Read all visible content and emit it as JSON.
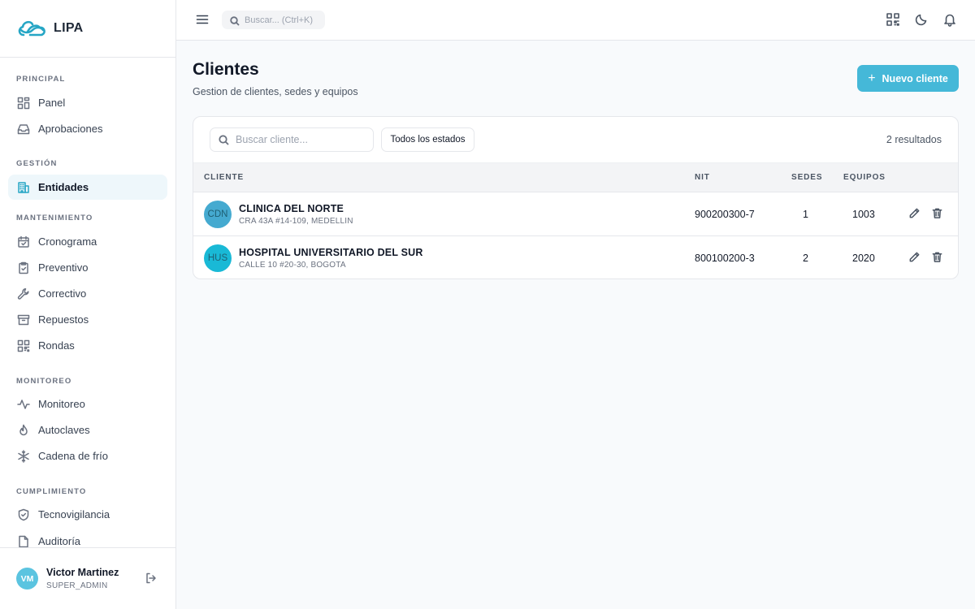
{
  "brand": {
    "name": "LIPA",
    "color": "#26a6c5"
  },
  "sidebar": {
    "sections": [
      {
        "title": "PRINCIPAL",
        "items": [
          {
            "label": "Panel",
            "icon": "grid-icon"
          },
          {
            "label": "Aprobaciones",
            "icon": "inbox-icon"
          }
        ]
      },
      {
        "title": "GESTIÓN",
        "items": [
          {
            "label": "Entidades",
            "icon": "building-icon",
            "active": true
          }
        ]
      },
      {
        "title": "MANTENIMIENTO",
        "items": [
          {
            "label": "Cronograma",
            "icon": "calendar-icon"
          },
          {
            "label": "Preventivo",
            "icon": "clipboard-icon"
          },
          {
            "label": "Correctivo",
            "icon": "wrench-icon"
          },
          {
            "label": "Repuestos",
            "icon": "archive-icon"
          },
          {
            "label": "Rondas",
            "icon": "qr-icon"
          }
        ]
      },
      {
        "title": "MONITOREO",
        "items": [
          {
            "label": "Monitoreo",
            "icon": "activity-icon"
          },
          {
            "label": "Autoclaves",
            "icon": "flame-icon"
          },
          {
            "label": "Cadena de frío",
            "icon": "snowflake-icon"
          }
        ]
      },
      {
        "title": "CUMPLIMIENTO",
        "items": [
          {
            "label": "Tecnovigilancia",
            "icon": "shield-icon"
          },
          {
            "label": "Auditoría",
            "icon": "file-icon"
          }
        ]
      }
    ]
  },
  "user": {
    "initials": "VM",
    "name": "Victor Martinez",
    "role": "SUPER_ADMIN"
  },
  "topbar": {
    "search_placeholder": "Buscar... (Ctrl+K)"
  },
  "page": {
    "title": "Clientes",
    "subtitle": "Gestion de clientes, sedes y equipos",
    "new_button": {
      "icon": "+",
      "label": "Nuevo cliente"
    }
  },
  "filters": {
    "search_placeholder": "Buscar cliente...",
    "status_label": "Todos los estados",
    "results": "2 resultados"
  },
  "table": {
    "headers": {
      "cliente": "CLIENTE",
      "nit": "NIT",
      "sedes": "SEDES",
      "equipos": "EQUIPOS"
    },
    "rows": [
      {
        "initials": "CDN",
        "avatar_color": "#45aad0",
        "name": "CLINICA DEL NORTE",
        "address": "CRA 43A #14-109, MEDELLIN",
        "nit": "900200300-7",
        "sedes": "1",
        "equipos": "1003"
      },
      {
        "initials": "HUS",
        "avatar_color": "#19b9d6",
        "name": "HOSPITAL UNIVERSITARIO DEL SUR",
        "address": "CALLE 10 #20-30, BOGOTA",
        "nit": "800100200-3",
        "sedes": "2",
        "equipos": "2020"
      }
    ]
  }
}
